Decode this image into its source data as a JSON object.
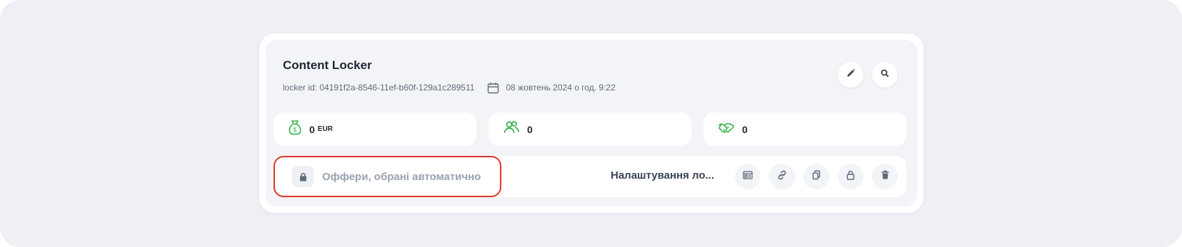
{
  "card": {
    "title": "Content Locker",
    "locker_id": "locker id: 04191f2a-8546-11ef-b60f-129a1c289511",
    "date": "08 жовтень 2024 о год. 9:22"
  },
  "stats": {
    "earnings_value": "0",
    "earnings_unit": "EUR",
    "users_value": "0",
    "deals_value": "0"
  },
  "offers": {
    "label": "Оффери, обрані автоматично"
  },
  "settings": {
    "label": "Налаштування ло..."
  },
  "colors": {
    "accent_green": "#35b34a",
    "highlight_red": "#e0362c",
    "icon_gray": "#5f6b7a"
  },
  "icons": [
    "pencil-icon",
    "search-icon",
    "calendar-icon",
    "money-bag-icon",
    "users-icon",
    "handshake-icon",
    "lock-icon",
    "layout-icon",
    "link-icon",
    "copy-icon",
    "trash-icon"
  ]
}
